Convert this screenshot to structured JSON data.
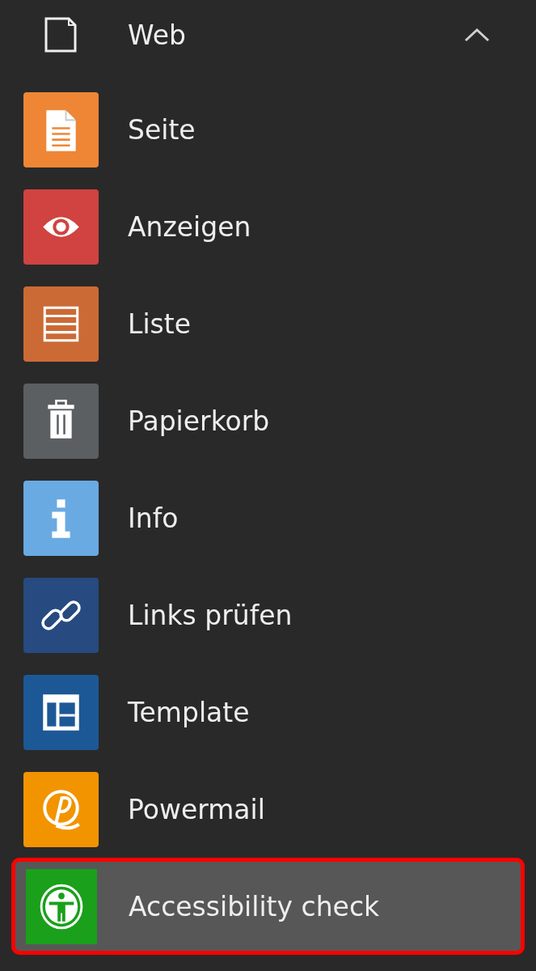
{
  "group": {
    "label": "Web",
    "expanded": true
  },
  "modules": [
    {
      "label": "Seite",
      "kind": "page",
      "color": "#ef8636",
      "selected": false
    },
    {
      "label": "Anzeigen",
      "kind": "eye",
      "color": "#d04340",
      "selected": false
    },
    {
      "label": "Liste",
      "kind": "list",
      "color": "#cc6a36",
      "selected": false
    },
    {
      "label": "Papierkorb",
      "kind": "trash",
      "color": "#5b5f62",
      "selected": false
    },
    {
      "label": "Info",
      "kind": "info",
      "color": "#6aaae2",
      "selected": false
    },
    {
      "label": "Links prüfen",
      "kind": "link",
      "color": "#274a80",
      "selected": false
    },
    {
      "label": "Template",
      "kind": "template",
      "color": "#1d5896",
      "selected": false
    },
    {
      "label": "Powermail",
      "kind": "powermail",
      "color": "#f29400",
      "selected": false
    },
    {
      "label": "Accessibility check",
      "kind": "accessibility",
      "color": "#1aa01a",
      "selected": true
    }
  ]
}
